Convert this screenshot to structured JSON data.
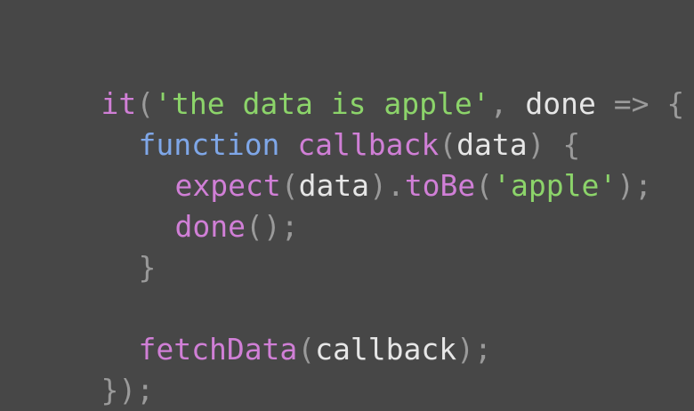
{
  "code": {
    "line1": {
      "fn": "it",
      "open": "(",
      "str": "'the data is apple'",
      "comma": ",",
      "param": "done",
      "arrow": "=>",
      "brace": "{"
    },
    "line2": {
      "kw": "function",
      "fn": "callback",
      "open": "(",
      "param": "data",
      "close": ")",
      "brace": "{"
    },
    "line3": {
      "fn": "expect",
      "open": "(",
      "param": "data",
      "close": ").",
      "fn2": "toBe",
      "open2": "(",
      "str": "'apple'",
      "close2": ");"
    },
    "line4": {
      "fn": "done",
      "rest": "();"
    },
    "line5": {
      "brace": "}"
    },
    "line7": {
      "fn": "fetchData",
      "open": "(",
      "param": "callback",
      "close": ");"
    },
    "line8": {
      "end": "});"
    }
  }
}
